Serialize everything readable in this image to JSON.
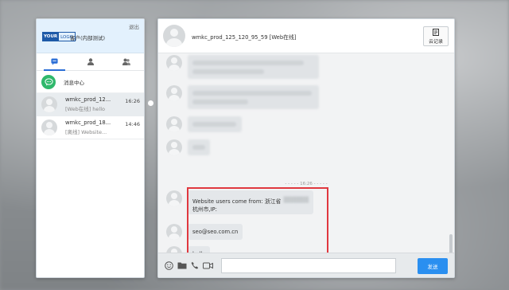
{
  "sidebar": {
    "logo_your": "YOUR",
    "logo_text": "LOGO",
    "client_name": "客户(内部测试)",
    "logout": "退出",
    "tabs": [
      {
        "icon": "chat-icon",
        "active": true
      },
      {
        "icon": "person-icon",
        "active": false
      },
      {
        "icon": "group-icon",
        "active": false
      }
    ],
    "message_center": "消息中心",
    "contacts": [
      {
        "name": "wmkc_prod_12...",
        "preview": "[Web在线] hello",
        "time": "16:26",
        "selected": true
      },
      {
        "name": "wmkc_prod_18...",
        "preview": "[离线] Website...",
        "time": "14:46",
        "selected": false
      }
    ]
  },
  "chat": {
    "title": "wmkc_prod_125_120_95_59 [Web在线]",
    "cloud_record": "云记录",
    "time_separator": "- - - - - 16:26 - - - - -",
    "messages": [
      {
        "text_prefix": "Website users come from: 浙江省杭州市,IP:",
        "text_redacted": "██████"
      },
      {
        "text": "seo@seo.com.cn"
      },
      {
        "text": "hello"
      }
    ],
    "input_placeholder": "",
    "send": "发送"
  },
  "colors": {
    "accent": "#2a8ff0",
    "green": "#2fb86b",
    "highlight": "#e0383f",
    "bubble": "#e4e7ea"
  }
}
